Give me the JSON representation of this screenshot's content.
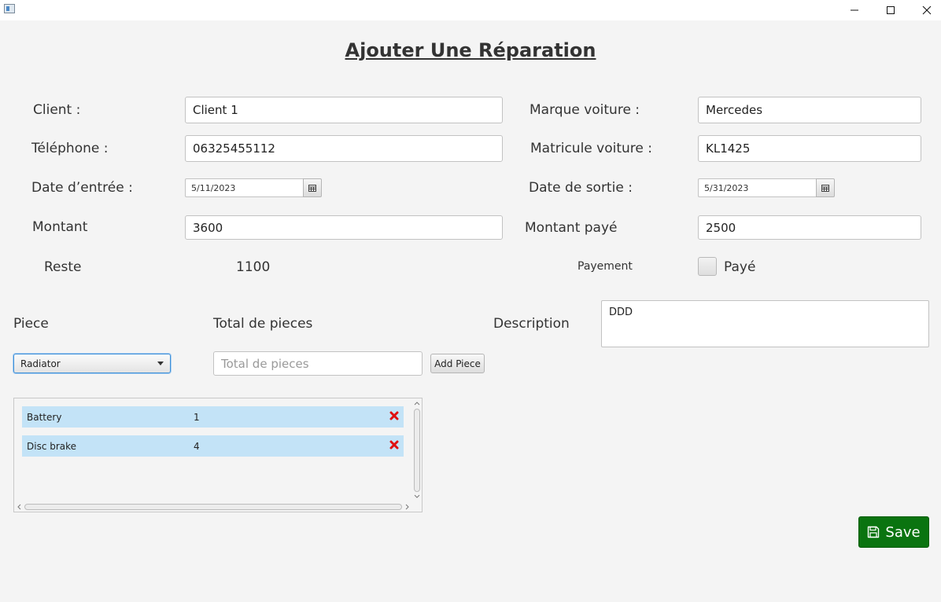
{
  "window": {
    "title": ""
  },
  "form": {
    "title": "Ajouter Une Réparation",
    "client": {
      "label": "Client :",
      "value": "Client 1"
    },
    "telephone": {
      "label": "Téléphone :",
      "value": "06325455112"
    },
    "date_entree": {
      "label": "Date d’entrée :",
      "value": "5/11/2023"
    },
    "montant": {
      "label": "Montant",
      "value": "3600"
    },
    "reste": {
      "label": "Reste",
      "value": "1100"
    },
    "marque": {
      "label": "Marque voiture :",
      "value": "Mercedes"
    },
    "matricule": {
      "label": "Matricule voiture :",
      "value": "KL1425"
    },
    "date_sortie": {
      "label": "Date de sortie :",
      "value": "5/31/2023"
    },
    "montant_paye": {
      "label": "Montant payé",
      "value": "2500"
    },
    "payement": {
      "label": "Payement",
      "checkbox_label": "Payé",
      "checked": false
    },
    "piece": {
      "label": "Piece",
      "selected": "Radiator"
    },
    "total_pieces": {
      "label": "Total de pieces",
      "placeholder": "Total de pieces",
      "value": ""
    },
    "add_piece_label": "Add Piece",
    "description": {
      "label": "Description",
      "value": "DDD"
    },
    "pieces_list": [
      {
        "name": "Battery",
        "qty": "1"
      },
      {
        "name": "Disc brake",
        "qty": "4"
      }
    ],
    "save_label": "Save"
  },
  "colors": {
    "save": "#0a7410",
    "row_highlight": "#c3e3f7",
    "delete": "#e01010",
    "focus": "#3c8fd8"
  }
}
